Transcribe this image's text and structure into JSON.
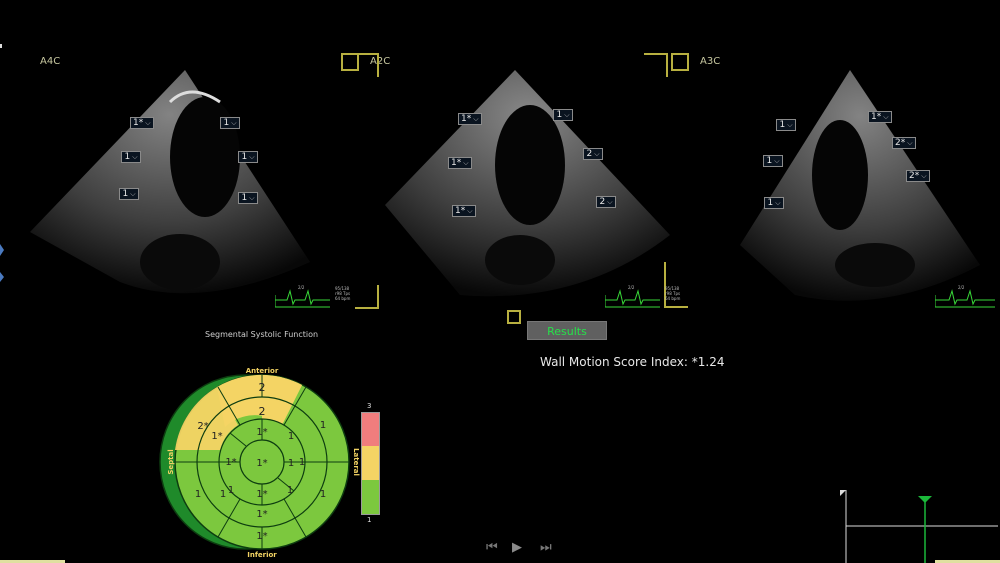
{
  "views": [
    {
      "label": "A4C"
    },
    {
      "label": "A2C"
    },
    {
      "label": "A3C"
    }
  ],
  "segments": {
    "a4c": [
      "1*",
      "1",
      "1",
      "1",
      "1",
      "1"
    ],
    "a2c": [
      "1*",
      "1",
      "1*",
      "2",
      "1*",
      "2"
    ],
    "a3c": [
      "1",
      "1*",
      "1",
      "2*",
      "2*",
      "1"
    ]
  },
  "ecg_info": {
    "hr_value": "2/2",
    "a4c_lines": [
      "95/138",
      "r98 Tps",
      "64 bpm"
    ],
    "a2c_lines": [
      "95/138",
      "r98 Tps",
      "64 bpm"
    ]
  },
  "results_button": "Results",
  "wmsi": "Wall Motion Score Index:  *1.24",
  "bullseye": {
    "title": "Segmental Systolic Function",
    "labels": {
      "anterior": "Anterior",
      "inferior": "Inferior",
      "septal": "Septal",
      "lateral": "Lateral"
    },
    "outer": [
      "2",
      "2",
      "1",
      "1",
      "1*",
      "1",
      "1",
      "2*",
      "1",
      "1"
    ],
    "mid": [
      "1*",
      "1",
      "1",
      "1*",
      "1*",
      "1"
    ],
    "apex": [
      "1*",
      "1*"
    ],
    "apex_center": "1*",
    "septal_outer": "2*"
  },
  "scale": {
    "max": "3",
    "min": "1"
  },
  "colors": {
    "normal": "#7cc83e",
    "hypo": "#f4d464",
    "akinetic": "#f07d7d",
    "accent": "#b8b040",
    "results_text": "#27e04a"
  },
  "playback": {
    "prev": "prev-frame-icon",
    "play": "play-icon",
    "next": "next-frame-icon"
  }
}
